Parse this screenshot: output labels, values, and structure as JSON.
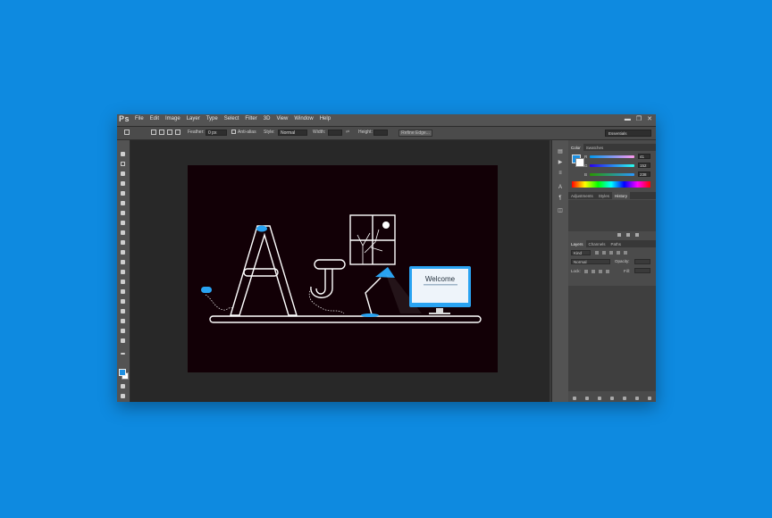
{
  "app": {
    "logo": "Ps"
  },
  "menu": [
    "File",
    "Edit",
    "Image",
    "Layer",
    "Type",
    "Select",
    "Filter",
    "3D",
    "View",
    "Window",
    "Help"
  ],
  "window_controls": {
    "minimize": "▬",
    "restore": "❐",
    "close": "✕"
  },
  "options_bar": {
    "feather_label": "Feather:",
    "feather_value": "0 px",
    "anti_alias_label": "Anti-alias",
    "style_label": "Style:",
    "style_value": "Normal",
    "width_label": "Width:",
    "height_label": "Height:",
    "refine_edge_label": "Refine Edge...",
    "workspace": "Essentials"
  },
  "canvas": {
    "document_background": "#120006",
    "illustration": {
      "monitor_text": "Welcome"
    }
  },
  "panels": {
    "color_tabs": [
      "Color",
      "Swatches"
    ],
    "color_values": {
      "r": "41",
      "g": "152",
      "b": "238"
    },
    "color_labels": {
      "r": "R",
      "g": "G",
      "b": "B"
    },
    "adjust_tabs": [
      "Adjustments",
      "Styles",
      "History"
    ],
    "layers_tabs": [
      "Layers",
      "Channels",
      "Paths"
    ],
    "layers_kind": "Kind",
    "layers_blend": "Normal",
    "layers_opacity_label": "Opacity:",
    "layers_lock_label": "Lock:",
    "layers_fill_label": "Fill:"
  },
  "colors": {
    "desktop": "#0e8ae0",
    "accent": "#1e8fe0"
  }
}
